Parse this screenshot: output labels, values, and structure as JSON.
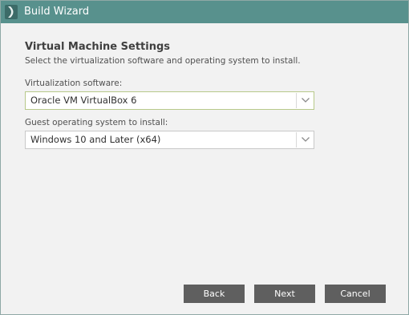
{
  "window": {
    "title": "Build Wizard",
    "icon": "wizard-chevron-icon"
  },
  "page": {
    "heading": "Virtual Machine Settings",
    "description": "Select the virtualization software and operating system to install."
  },
  "fields": {
    "virtualization": {
      "label": "Virtualization software:",
      "value": "Oracle VM VirtualBox 6"
    },
    "guest_os": {
      "label": "Guest operating system to install:",
      "value": "Windows 10 and Later (x64)"
    }
  },
  "buttons": {
    "back": "Back",
    "next": "Next",
    "cancel": "Cancel"
  },
  "colors": {
    "titlebar": "#58918d",
    "button": "#5f5f5f",
    "focus_border": "#b7c98a",
    "background": "#f2f2f2"
  }
}
